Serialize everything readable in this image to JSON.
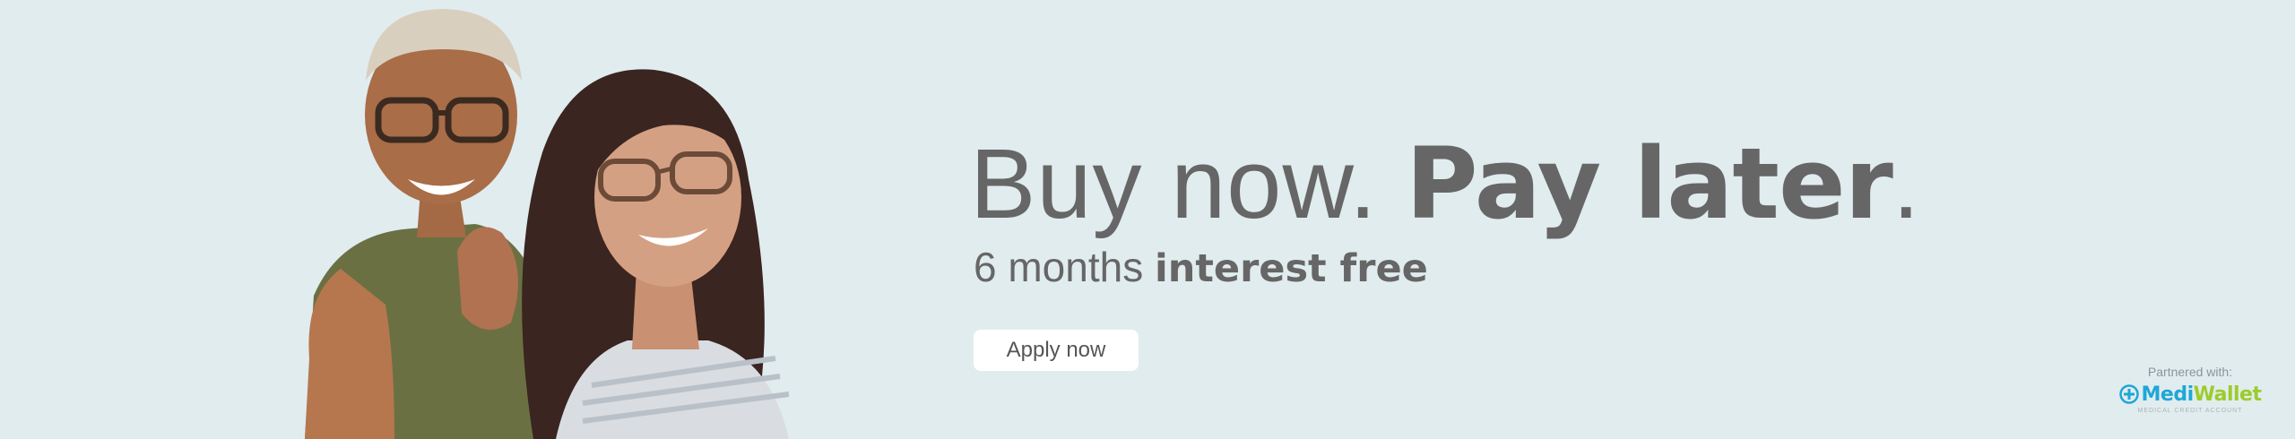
{
  "hero": {
    "headline_light": "Buy now. ",
    "headline_bold": "Pay later",
    "headline_end": ".",
    "subhead_light": "6 months ",
    "subhead_bold": "interest free",
    "apply_label": "Apply now"
  },
  "partner": {
    "label": "Partnered with:",
    "brand_first": "Medi",
    "brand_second": "Wallet",
    "tagline": "MEDICAL CREDIT ACCOUNT"
  },
  "colors": {
    "background": "#e1ecef",
    "text": "#666666",
    "button_bg": "#ffffff",
    "brand_blue": "#1ea7d6",
    "brand_green": "#9ccc2a"
  },
  "icons": [
    "medical-plus-icon"
  ]
}
